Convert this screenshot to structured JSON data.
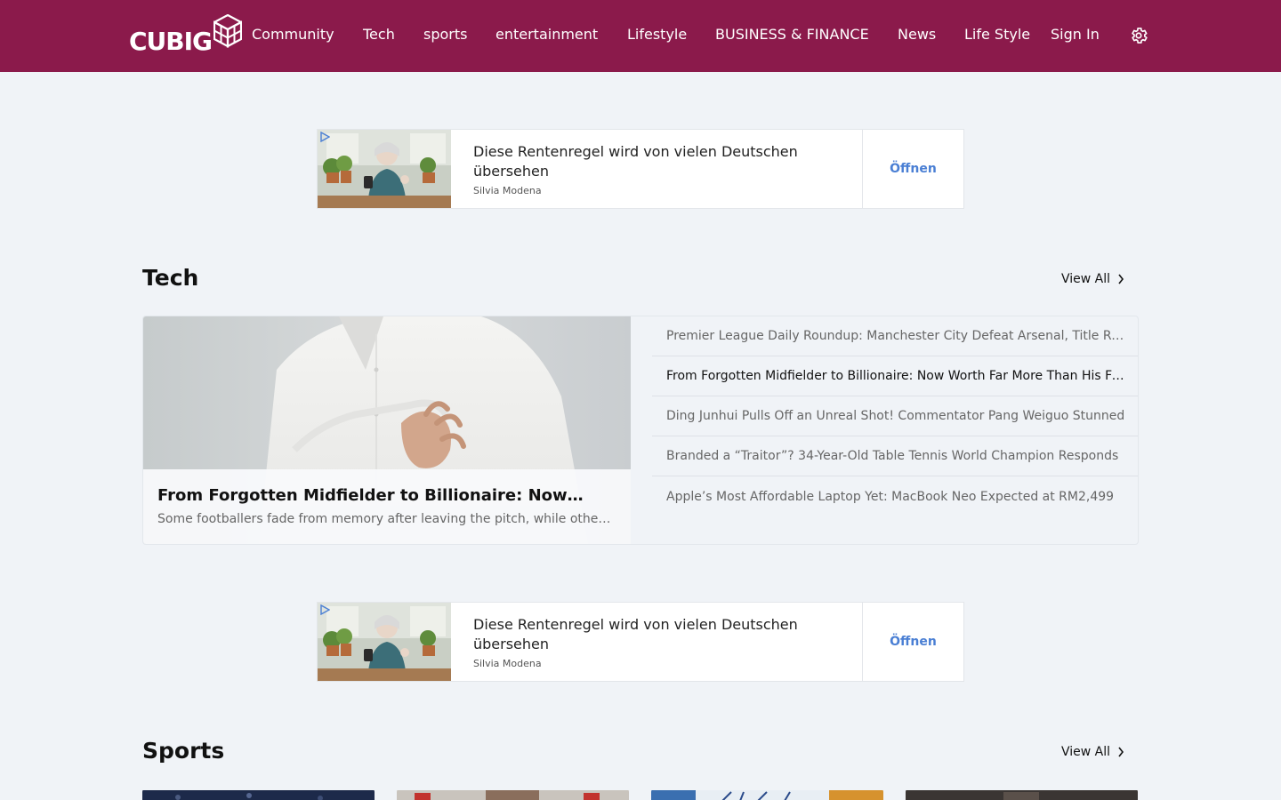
{
  "header": {
    "logo_text": "CUBIG",
    "nav": [
      {
        "label": "Community"
      },
      {
        "label": "Tech"
      },
      {
        "label": "sports"
      },
      {
        "label": "entertainment"
      },
      {
        "label": "Lifestyle"
      },
      {
        "label": "BUSINESS & FINANCE"
      },
      {
        "label": "News"
      },
      {
        "label": "Life Style"
      }
    ],
    "sign_in": "Sign In",
    "settings_icon": "gear-icon"
  },
  "ads": [
    {
      "title": "Diese Rentenregel wird von vielen Deutschen übersehen",
      "author": "Silvia Modena",
      "button": "Öffnen"
    },
    {
      "title": "Diese Rentenregel wird von vielen Deutschen übersehen",
      "author": "Silvia Modena",
      "button": "Öffnen"
    }
  ],
  "tech": {
    "title": "Tech",
    "view_all": "View All",
    "feature": {
      "title": "From Forgotten Midfielder to Billionaire: Now Worth Far More Than His Former Teammates",
      "description": "Some footballers fade from memory after leaving the pitch, while others go on to build fortunes far beyond the game."
    },
    "stories": [
      {
        "title": "Premier League Daily Roundup: Manchester City Defeat Arsenal, Title Race Heats Up",
        "active": false
      },
      {
        "title": "From Forgotten Midfielder to Billionaire: Now Worth Far More Than His Former Teammates",
        "active": true
      },
      {
        "title": "Ding Junhui Pulls Off an Unreal Shot! Commentator Pang Weiguo Stunned",
        "active": false
      },
      {
        "title": "Branded a “Traitor”? 34-Year-Old Table Tennis World Champion Responds",
        "active": false
      },
      {
        "title": "Apple’s Most Affordable Laptop Yet: MacBook Neo Expected at RM2,499",
        "active": false
      }
    ]
  },
  "sports": {
    "title": "Sports",
    "view_all": "View All"
  },
  "colors": {
    "header_bg": "#8b1a4b",
    "page_bg": "#f0f3f7",
    "ad_button": "#4a7fd4"
  }
}
